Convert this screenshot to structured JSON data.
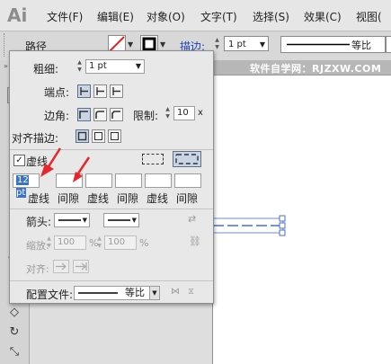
{
  "app": {
    "logo": "Ai"
  },
  "menu": [
    "文件(F)",
    "编辑(E)",
    "对象(O)",
    "文字(T)",
    "选择(S)",
    "效果(C)",
    "视图("
  ],
  "controlbar": {
    "object_label": "路径",
    "stroke_label": "描边:",
    "stroke_value": "1 pt",
    "profile_label": "等比"
  },
  "watermark": "软件自学网：RJZXW.COM",
  "stroke_panel": {
    "weight_label": "粗细:",
    "weight_value": "1 pt",
    "cap_label": "端点:",
    "corner_label": "边角:",
    "limit_label": "限制:",
    "limit_value": "10",
    "limit_unit": "x",
    "align_label": "对齐描边:",
    "dashed_label": "虚线",
    "dashed_checked": true,
    "dash_fields": [
      {
        "value": "12 pt",
        "label": "虚线"
      },
      {
        "value": "",
        "label": "间隙"
      },
      {
        "value": "",
        "label": "虚线"
      },
      {
        "value": "",
        "label": "间隙"
      },
      {
        "value": "",
        "label": "虚线"
      },
      {
        "value": "",
        "label": "间隙"
      }
    ],
    "arrow_label": "箭头:",
    "scale_label": "缩放:",
    "scale_start": "100",
    "scale_end": "100",
    "percent": "%",
    "align_arrow_label": "对齐:",
    "profile_label": "配置文件:",
    "profile_value": "等比"
  },
  "colors": {
    "annotation_arrow": "#e8262a",
    "selection": "#3a73c6",
    "path_stroke": "#4a6fc8"
  }
}
